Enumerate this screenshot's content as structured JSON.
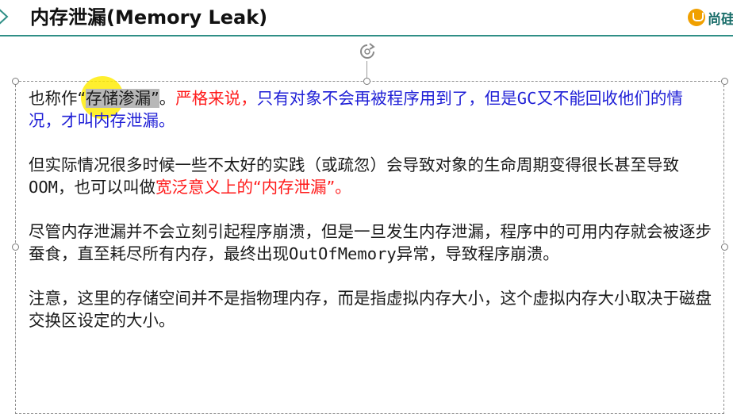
{
  "header": {
    "title": "内存泄漏(Memory Leak)",
    "logo_text": "尚硅"
  },
  "slide": {
    "p1": {
      "a": "也称作",
      "b": "“",
      "c": "存储渗漏”",
      "d": "。",
      "red": "严格来说，",
      "blue_1": "只有对象不会再被程序用到了，但是",
      "blue_gc": "GC",
      "blue_2": "又不能回收他们的情况，才叫内存泄漏。"
    },
    "p2": {
      "a": "但实际情况很多时候一些不太好的实践（或疏忽）会导致对象的生命周期变得很长甚至导致",
      "oom": "OOM",
      "b": "，也可以叫做",
      "red": "宽泛意义上的“内存泄漏”。"
    },
    "p3": {
      "a": "尽管内存泄漏并不会立刻引起程序崩溃，但是一旦发生内存泄漏，程序中的可用内存就会被逐步蚕食，直至耗尽所有内存，最终出现",
      "mono": "OutOfMemory",
      "b": "异常，导致程序崩溃。"
    },
    "p4": {
      "a": "注意，这里的存储空间并不是指物理内存，而是指虚拟内存大小，这个虚拟内存大小取决于磁盘交换区设定的大小。"
    }
  },
  "colors": {
    "accent_rule": "#2f8f86",
    "emphasis_red": "#ff1a1a",
    "emphasis_blue": "#1f1fd6",
    "selection": "#b8b8b8",
    "cursor_highlight": "#ffec00",
    "logo_orange": "#f0a000"
  },
  "icons": [
    "chevron-right-icon",
    "rotate-handle-icon",
    "logo-icon"
  ]
}
